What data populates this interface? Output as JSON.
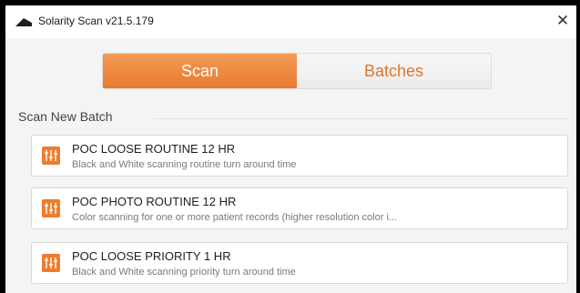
{
  "window": {
    "title": "Solarity Scan v21.5.179",
    "close_glyph": "✕"
  },
  "tabs": [
    {
      "label": "Scan",
      "active": true
    },
    {
      "label": "Batches",
      "active": false
    }
  ],
  "section": {
    "title": "Scan New Batch"
  },
  "batches": [
    {
      "title": "POC LOOSE ROUTINE 12 HR",
      "description": "Black and White scanning routine turn around time"
    },
    {
      "title": "POC PHOTO ROUTINE 12 HR",
      "description": "Color scanning for one or more patient records (higher resolution color i..."
    },
    {
      "title": "POC LOOSE PRIORITY 1 HR",
      "description": "Black and White scanning priority turn around time"
    }
  ],
  "icons": {
    "app": "scanner-icon",
    "batch": "sliders-icon"
  },
  "colors": {
    "accent": "#ee7d2b",
    "tab_inactive_text": "#e0762a",
    "background": "#f4f4f4"
  }
}
